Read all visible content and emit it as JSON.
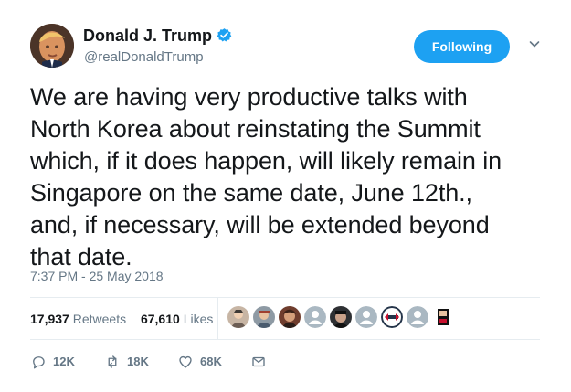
{
  "user": {
    "name": "Donald J. Trump",
    "handle": "@realDonaldTrump",
    "verified": true
  },
  "follow_button": {
    "label": "Following"
  },
  "tweet": {
    "text": "We are having very productive talks with\nNorth Korea about reinstating the Summit\nwhich, if it does happen, will likely remain in\nSingapore on the same date, June 12th.,\nand, if necessary, will be extended beyond\nthat date.",
    "timestamp": "7:37 PM - 25 May 2018"
  },
  "stats": {
    "retweets_count": "17,937",
    "retweets_label": "Retweets",
    "likes_count": "67,610",
    "likes_label": "Likes"
  },
  "actions": {
    "reply_count": "12K",
    "retweet_count": "18K",
    "like_count": "68K"
  },
  "likers": [
    {
      "avatar": "user-avatar-1"
    },
    {
      "avatar": "user-avatar-2"
    },
    {
      "avatar": "user-avatar-3"
    },
    {
      "avatar": "user-avatar-4"
    },
    {
      "avatar": "user-avatar-5"
    },
    {
      "avatar": "user-avatar-6"
    },
    {
      "avatar": "user-avatar-7"
    },
    {
      "avatar": "user-avatar-8"
    },
    {
      "avatar": "user-avatar-9"
    }
  ],
  "colors": {
    "accent": "#1da1f2",
    "text": "#14171a",
    "muted": "#657786",
    "divider": "#e6ecf0"
  },
  "icons": {
    "verified": "verified-badge-icon",
    "caret": "chevron-down-icon",
    "reply": "reply-icon",
    "retweet": "retweet-icon",
    "like": "heart-icon",
    "message": "direct-message-icon"
  }
}
